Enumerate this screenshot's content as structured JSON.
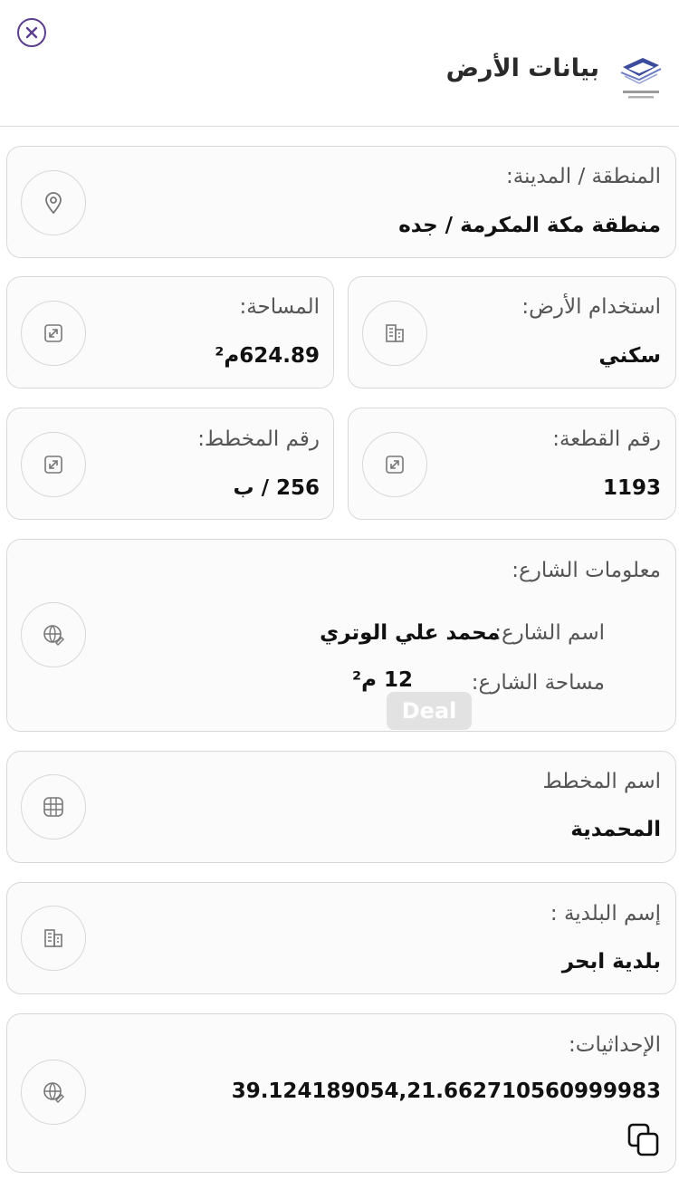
{
  "header": {
    "title": "بيانات الأرض",
    "close_icon": "close-icon",
    "logo_icon": "ministry-logo-icon"
  },
  "region": {
    "label": "المنطقة / المدينة:",
    "value": "منطقة مكة المكرمة / جده",
    "icon": "location-pin-icon"
  },
  "land_use": {
    "label": "استخدام الأرض:",
    "value": "سكني",
    "icon": "building-icon"
  },
  "area": {
    "label": "المساحة:",
    "value": "624.89م²",
    "icon": "expand-icon"
  },
  "parcel_number": {
    "label": "رقم القطعة:",
    "value": "1193",
    "icon": "expand-icon"
  },
  "plan_number": {
    "label": "رقم المخطط:",
    "value": "256 / ب",
    "icon": "expand-icon"
  },
  "street_info": {
    "label": "معلومات الشارع:",
    "name_label": "اسم الشارع:",
    "name_value": "محمد علي الوتري",
    "area_label": "مساحة الشارع:",
    "area_value": "12 م²",
    "icon": "globe-edit-icon"
  },
  "plan_name": {
    "label": "اسم المخطط",
    "value": "المحمدية",
    "icon": "grid-icon"
  },
  "municipality": {
    "label": "إسم البلدية :",
    "value": "بلدية ابحر",
    "icon": "building-icon"
  },
  "coordinates": {
    "label": "الإحداثيات:",
    "value": "39.124189054,21.662710560999983",
    "icon": "globe-edit-icon",
    "copy_icon": "copy-icon"
  },
  "watermark": {
    "text": "Deal"
  },
  "colors": {
    "accent": "#5b3f8e",
    "border": "#d8d8d8",
    "card_bg": "#fbfbfb"
  }
}
